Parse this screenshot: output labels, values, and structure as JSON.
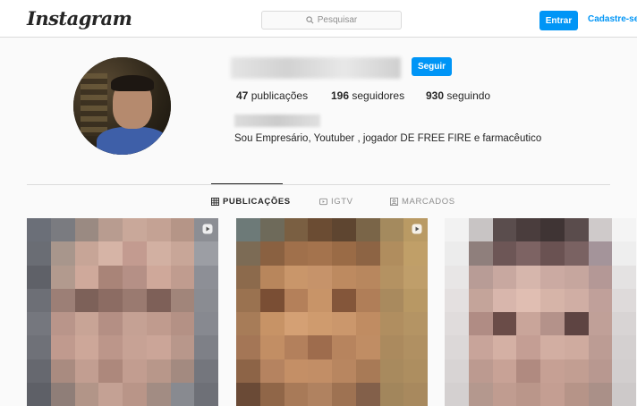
{
  "header": {
    "logo": "Instagram",
    "search_placeholder": "Pesquisar",
    "login_label": "Entrar",
    "signup_label": "Cadastre-se"
  },
  "profile": {
    "follow_label": "Seguir",
    "posts_count": "47",
    "posts_label": "publicações",
    "followers_count": "196",
    "followers_label": "seguidores",
    "following_count": "930",
    "following_label": "seguindo",
    "bio": "Sou Empresário, Youtuber , jogador DE FREE FIRE e farmacêutico"
  },
  "tabs": [
    {
      "label": "PUBLICAÇÕES",
      "icon": "grid-icon",
      "active": true
    },
    {
      "label": "IGTV",
      "icon": "tv-icon",
      "active": false
    },
    {
      "label": "MARCADOS",
      "icon": "tagged-icon",
      "active": false
    }
  ],
  "posts": [
    {
      "type": "video",
      "icon": "reel-icon"
    },
    {
      "type": "video",
      "icon": "reel-icon"
    },
    {
      "type": "photo"
    }
  ],
  "colors": {
    "accent": "#0095f6",
    "background": "#fafafa",
    "text": "#262626",
    "muted": "#8e8e8e",
    "border": "#dbdbdb"
  }
}
